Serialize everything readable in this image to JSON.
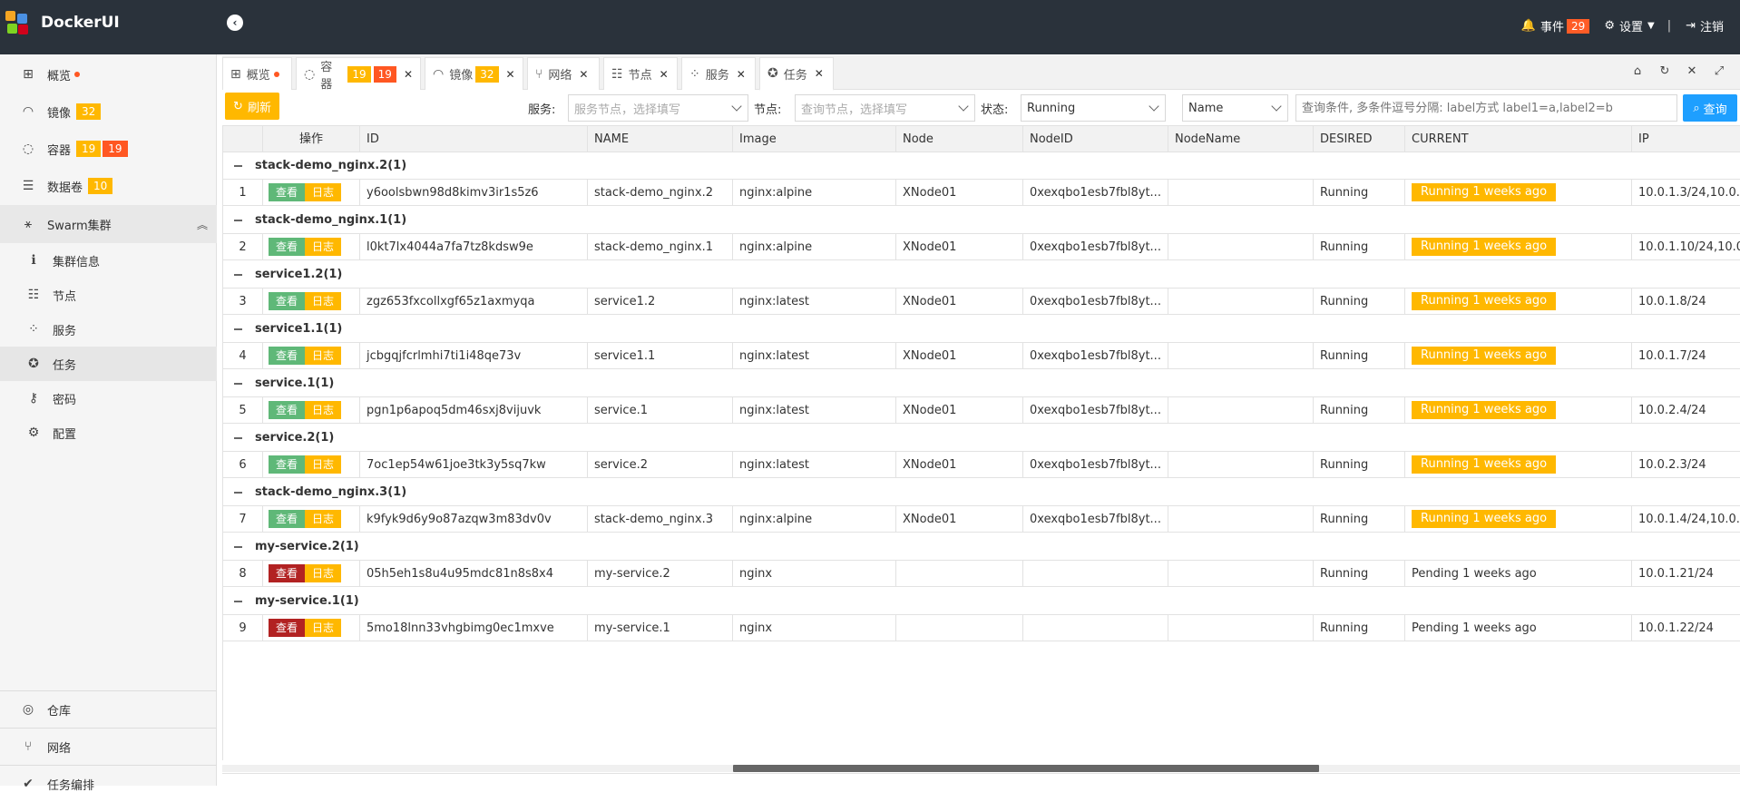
{
  "app": {
    "title": "DockerUI"
  },
  "topbar": {
    "events_label": "事件",
    "events_count": "29",
    "settings_label": "设置",
    "logout_label": "注销"
  },
  "sidebar": {
    "items": [
      {
        "label": "概览",
        "icon": "windows-icon"
      },
      {
        "label": "镜像",
        "icon": "headset-icon",
        "badge": "32"
      },
      {
        "label": "容器",
        "icon": "refresh-circle-icon",
        "badge1": "19",
        "badge2": "19"
      },
      {
        "label": "数据卷",
        "icon": "database-icon",
        "badge": "10"
      },
      {
        "label": "Swarm集群",
        "icon": "sitemap-icon"
      },
      {
        "label": "集群信息",
        "icon": "info-icon"
      },
      {
        "label": "节点",
        "icon": "server-icon"
      },
      {
        "label": "服务",
        "icon": "spinner-icon"
      },
      {
        "label": "任务",
        "icon": "rebel-icon"
      },
      {
        "label": "密码",
        "icon": "key-icon"
      },
      {
        "label": "配置",
        "icon": "gear-icon"
      },
      {
        "label": "仓库",
        "icon": "podcast-icon"
      },
      {
        "label": "网络",
        "icon": "usb-icon"
      },
      {
        "label": "任务编排",
        "icon": "tasks-icon"
      }
    ]
  },
  "tabs": [
    {
      "label": "概览"
    },
    {
      "label": "容器",
      "badge1": "19",
      "badge2": "19"
    },
    {
      "label": "镜像",
      "badge": "32"
    },
    {
      "label": "网络"
    },
    {
      "label": "节点"
    },
    {
      "label": "服务"
    },
    {
      "label": "任务"
    }
  ],
  "toolbar": {
    "refresh_label": "刷新",
    "service_label": "服务:",
    "service_placeholder": "服务节点，选择填写",
    "node_label": "节点:",
    "node_placeholder": "查询节点，选择填写",
    "state_label": "状态:",
    "state_value": "Running",
    "sort_value": "Name",
    "query_placeholder": "查询条件, 多条件逗号分隔: label方式 label1=a,label2=b",
    "search_label": "查询"
  },
  "table": {
    "columns": [
      "操作",
      "ID",
      "NAME",
      "Image",
      "Node",
      "NodeID",
      "NodeName",
      "DESIRED",
      "CURRENT",
      "IP"
    ],
    "view_label": "查看",
    "log_label": "日志",
    "groups": [
      {
        "title": "stack-demo_nginx.2(1)",
        "row": {
          "n": "1",
          "id": "y6oolsbwn98d8kimv3ir1s5z6",
          "name": "stack-demo_nginx.2",
          "image": "nginx:alpine",
          "node": "XNode01",
          "nodeid": "0xexqbo1esb7fbl8yt...",
          "nodename": "",
          "desired": "Running",
          "current": "Running 1 weeks ago",
          "ip": "10.0.1.3/24,10.0.",
          "state": "running"
        }
      },
      {
        "title": "stack-demo_nginx.1(1)",
        "row": {
          "n": "2",
          "id": "l0kt7lx4044a7fa7tz8kdsw9e",
          "name": "stack-demo_nginx.1",
          "image": "nginx:alpine",
          "node": "XNode01",
          "nodeid": "0xexqbo1esb7fbl8yt...",
          "nodename": "",
          "desired": "Running",
          "current": "Running 1 weeks ago",
          "ip": "10.0.1.10/24,10.0.",
          "state": "running"
        }
      },
      {
        "title": "service1.2(1)",
        "row": {
          "n": "3",
          "id": "zgz653fxcollxgf65z1axmyqa",
          "name": "service1.2",
          "image": "nginx:latest",
          "node": "XNode01",
          "nodeid": "0xexqbo1esb7fbl8yt...",
          "nodename": "",
          "desired": "Running",
          "current": "Running 1 weeks ago",
          "ip": "10.0.1.8/24",
          "state": "running"
        }
      },
      {
        "title": "service1.1(1)",
        "row": {
          "n": "4",
          "id": "jcbgqjfcrlmhi7ti1i48qe73v",
          "name": "service1.1",
          "image": "nginx:latest",
          "node": "XNode01",
          "nodeid": "0xexqbo1esb7fbl8yt...",
          "nodename": "",
          "desired": "Running",
          "current": "Running 1 weeks ago",
          "ip": "10.0.1.7/24",
          "state": "running"
        }
      },
      {
        "title": "service.1(1)",
        "row": {
          "n": "5",
          "id": "pgn1p6apoq5dm46sxj8vijuvk",
          "name": "service.1",
          "image": "nginx:latest",
          "node": "XNode01",
          "nodeid": "0xexqbo1esb7fbl8yt...",
          "nodename": "",
          "desired": "Running",
          "current": "Running 1 weeks ago",
          "ip": "10.0.2.4/24",
          "state": "running"
        }
      },
      {
        "title": "service.2(1)",
        "row": {
          "n": "6",
          "id": "7oc1ep54w61joe3tk3y5sq7kw",
          "name": "service.2",
          "image": "nginx:latest",
          "node": "XNode01",
          "nodeid": "0xexqbo1esb7fbl8yt...",
          "nodename": "",
          "desired": "Running",
          "current": "Running 1 weeks ago",
          "ip": "10.0.2.3/24",
          "state": "running"
        }
      },
      {
        "title": "stack-demo_nginx.3(1)",
        "row": {
          "n": "7",
          "id": "k9fyk9d6y9o87azqw3m83dv0v",
          "name": "stack-demo_nginx.3",
          "image": "nginx:alpine",
          "node": "XNode01",
          "nodeid": "0xexqbo1esb7fbl8yt...",
          "nodename": "",
          "desired": "Running",
          "current": "Running 1 weeks ago",
          "ip": "10.0.1.4/24,10.0.",
          "state": "running"
        }
      },
      {
        "title": "my-service.2(1)",
        "row": {
          "n": "8",
          "id": "05h5eh1s8u4u95mdc81n8s8x4",
          "name": "my-service.2",
          "image": "nginx",
          "node": "",
          "nodeid": "",
          "nodename": "",
          "desired": "Running",
          "current": "Pending 1 weeks ago",
          "ip": "10.0.1.21/24",
          "state": "pending"
        }
      },
      {
        "title": "my-service.1(1)",
        "row": {
          "n": "9",
          "id": "5mo18lnn33vhgbimg0ec1mxve",
          "name": "my-service.1",
          "image": "nginx",
          "node": "",
          "nodeid": "",
          "nodename": "",
          "desired": "Running",
          "current": "Pending 1 weeks ago",
          "ip": "10.0.1.22/24",
          "state": "pending"
        }
      }
    ]
  },
  "colors": {
    "topbar": "#2a323b",
    "orange": "#ffb800",
    "red": "#ff5722",
    "green": "#5fb878",
    "blue": "#1e9fff",
    "dark_red": "#b22222"
  }
}
